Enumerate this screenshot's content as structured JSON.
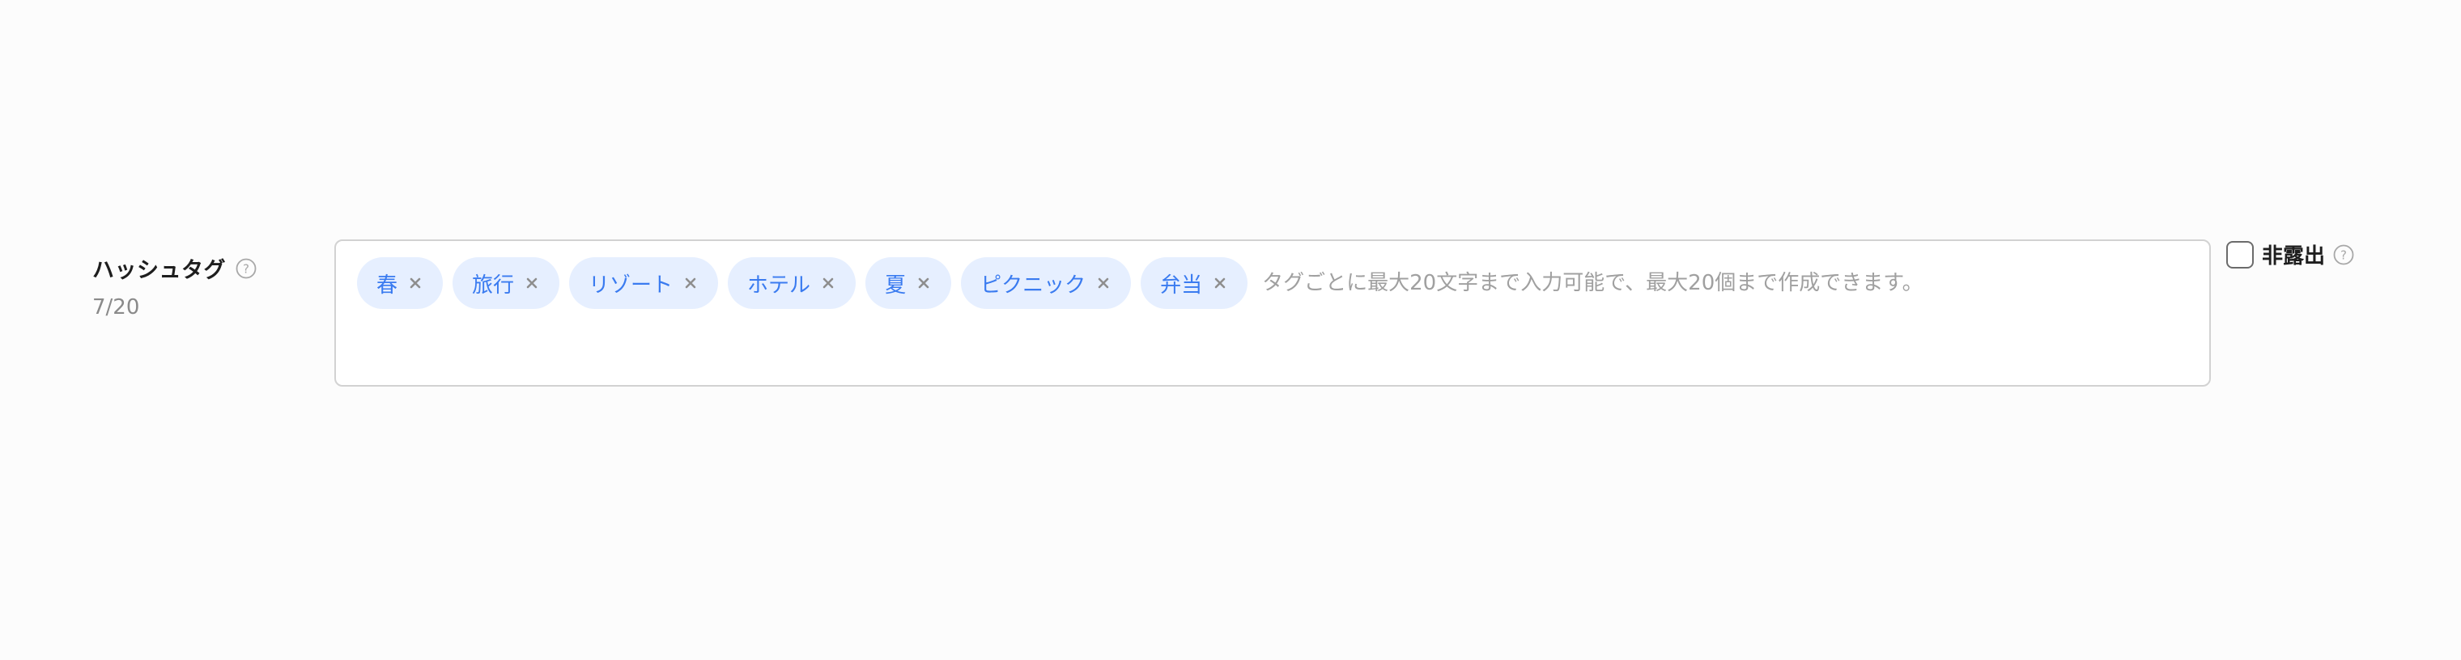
{
  "field": {
    "label": "ハッシュタグ",
    "count": "7/20"
  },
  "tags": [
    {
      "label": "春"
    },
    {
      "label": "旅行"
    },
    {
      "label": "リゾート"
    },
    {
      "label": "ホテル"
    },
    {
      "label": "夏"
    },
    {
      "label": "ピクニック"
    },
    {
      "label": "弁当"
    }
  ],
  "input": {
    "placeholder": "タグごとに最大20文字まで入力可能で、最大20個まで作成できます。",
    "value": ""
  },
  "hide_option": {
    "label": "非露出",
    "checked": false
  },
  "colors": {
    "chip_bg": "#e6efff",
    "chip_text": "#3a7bf0",
    "border": "#d2d2d2"
  },
  "icons": {
    "help": "help-circle-icon",
    "remove": "close-icon"
  }
}
